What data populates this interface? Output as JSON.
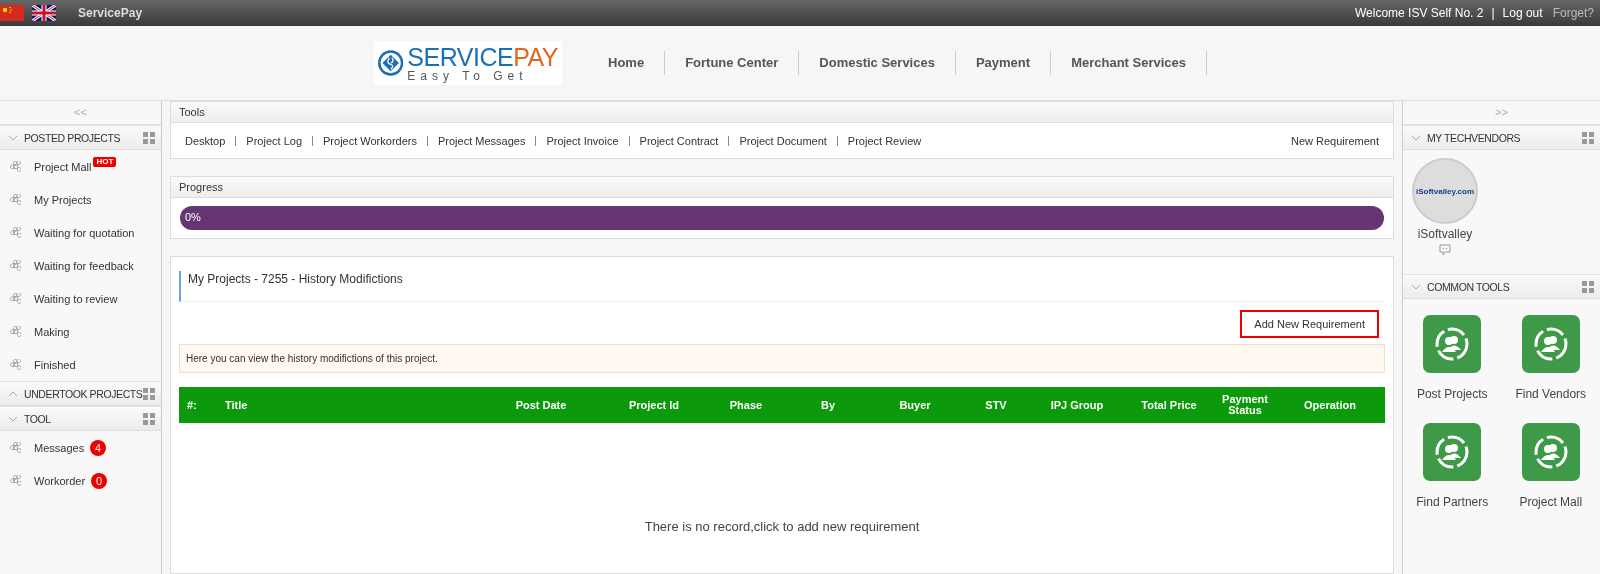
{
  "top_bar": {
    "site_name": "ServicePay",
    "welcome": "Welcome ISV Self No. 2",
    "separator": "|",
    "logout": "Log out",
    "forget": "Forget?"
  },
  "logo": {
    "name_start": "SERVICE",
    "name_end": "PAY",
    "tagline": "Easy To Get"
  },
  "nav": [
    {
      "label": "Home"
    },
    {
      "label": "Fortune Center"
    },
    {
      "label": "Domestic Services"
    },
    {
      "label": "Payment"
    },
    {
      "label": "Merchant Services"
    }
  ],
  "left_sidebar": {
    "collapse": "<<",
    "sections": [
      {
        "title": "POSTED PROJECTS",
        "expanded": true,
        "items": [
          {
            "label": "Project Mall",
            "tag": "HOT"
          },
          {
            "label": "My Projects"
          },
          {
            "label": "Waiting for quotation"
          },
          {
            "label": "Waiting for feedback"
          },
          {
            "label": "Waiting to review"
          },
          {
            "label": "Making"
          },
          {
            "label": "Finished"
          }
        ]
      },
      {
        "title": "UNDERTOOK PROJECTS",
        "expanded": false
      },
      {
        "title": "TOOL",
        "expanded": true,
        "items": [
          {
            "label": "Messages",
            "count": "4"
          },
          {
            "label": "Workorder",
            "count": "0"
          }
        ]
      }
    ]
  },
  "tools": {
    "title": "Tools",
    "links": [
      {
        "label": "Desktop"
      },
      {
        "label": "Project Log"
      },
      {
        "label": "Project Workorders"
      },
      {
        "label": "Project Messages"
      },
      {
        "label": "Project Invoice"
      },
      {
        "label": "Project Contract"
      },
      {
        "label": "Project Document"
      },
      {
        "label": "Project Review"
      }
    ],
    "new_requirement": "New Requirement"
  },
  "progress": {
    "title": "Progress",
    "level": 0,
    "reading": "0%"
  },
  "project": {
    "title": "My Projects - 7255 - History Modifictions",
    "add_button": "Add New Requirement",
    "notice": "Here you can view the history modifictions of this project.",
    "table": {
      "columns": [
        "#:",
        "Title",
        "Post Date",
        "Project Id",
        "Phase",
        "By",
        "Buyer",
        "STV",
        "IPJ Group",
        "Total Price",
        "Payment Status",
        "Operation"
      ],
      "empty_message": "There is no record,click to add new requirement"
    }
  },
  "right_sidebar": {
    "collapse": ">>",
    "techvendors": {
      "title": "MY TECHVENDORS",
      "expanded": true,
      "vendors": [
        {
          "name": "iSoftvalley",
          "logo_text": "iSoftvalley.com"
        }
      ]
    },
    "common_tools": {
      "title": "COMMON TOOLS",
      "expanded": true,
      "tools": [
        {
          "label": "Post Projects"
        },
        {
          "label": "Find Vendors"
        },
        {
          "label": "Find Partners"
        },
        {
          "label": "Project Mall"
        }
      ]
    }
  }
}
